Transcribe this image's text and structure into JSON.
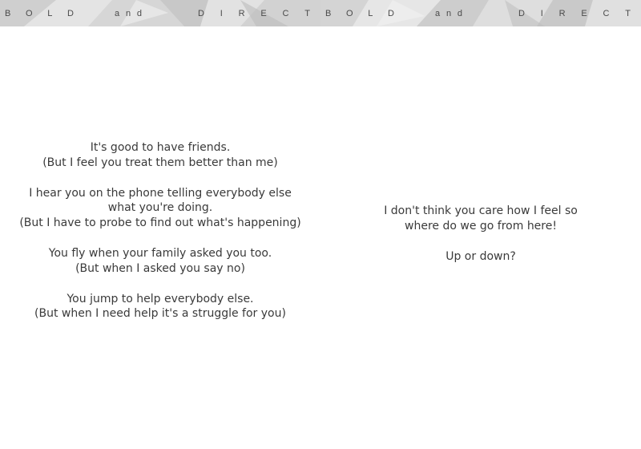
{
  "header": {
    "words": [
      {
        "letters": [
          "B",
          "O",
          "L",
          "D"
        ]
      },
      {
        "letters": [
          "a",
          "n",
          "d"
        ]
      },
      {
        "letters": [
          "D",
          "I",
          "R",
          "E",
          "C",
          "T"
        ]
      }
    ]
  },
  "left_page": {
    "stanzas": [
      [
        "It's good to have friends.",
        "(But I feel you treat them better than me)"
      ],
      [
        "I hear you on the phone telling everybody else",
        "what you're doing.",
        "(But I have to probe to find out what's happening)"
      ],
      [
        "You fly when your family asked you too.",
        "(But when I asked you say no)"
      ],
      [
        "You jump to help everybody else.",
        "(But when I need help it's a struggle for you)"
      ]
    ]
  },
  "right_page": {
    "stanzas": [
      [
        "I don't think you care how I feel so",
        "where do we go from here!"
      ],
      [
        "Up or down?"
      ]
    ]
  }
}
